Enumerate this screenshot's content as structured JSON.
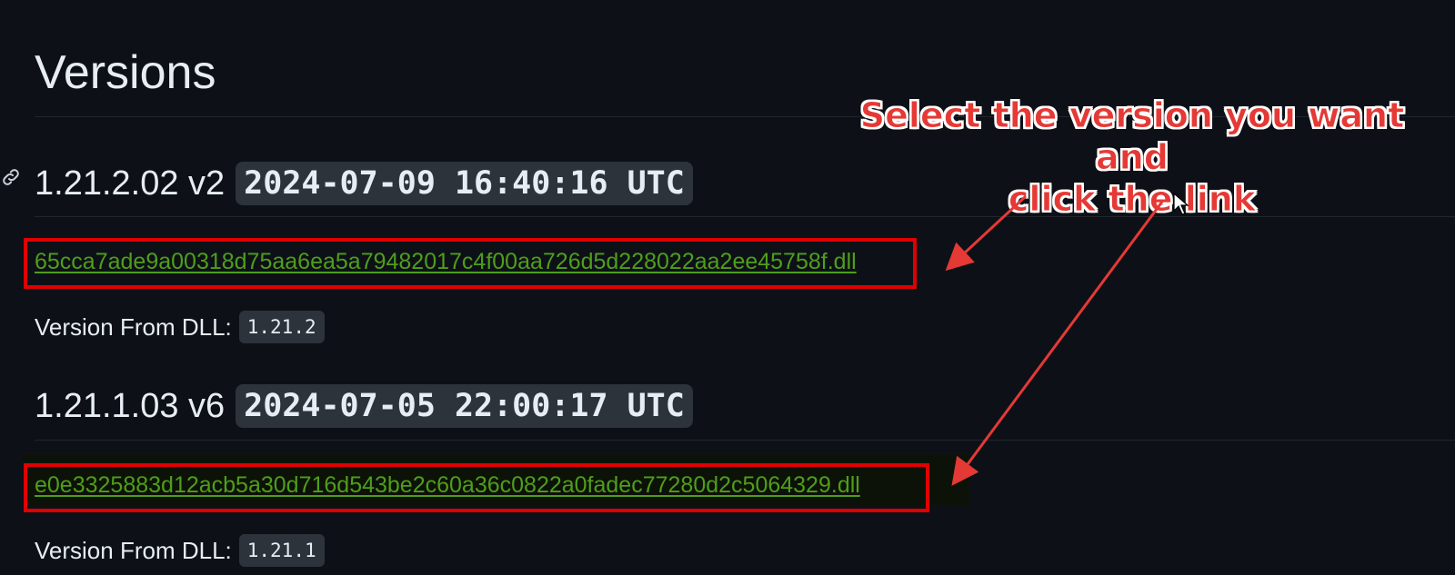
{
  "page": {
    "title": "Versions"
  },
  "versions": [
    {
      "name": "1.21.2.02 v2",
      "date": "2024-07-09 16:40:16 UTC",
      "dll": "65cca7ade9a00318d75aa6ea5a79482017c4f00aa726d5d228022aa2ee45758f.dll",
      "dll_version_label": "Version From DLL:",
      "dll_version": "1.21.2"
    },
    {
      "name": "1.21.1.03 v6",
      "date": "2024-07-05 22:00:17 UTC",
      "dll": "e0e3325883d12acb5a30d716d543be2c60a36c0822a0fadec77280d2c5064329.dll",
      "dll_version_label": "Version From DLL:",
      "dll_version": "1.21.1"
    }
  ],
  "annotation": {
    "line1": "Select the version you want and",
    "line2": "click the link"
  },
  "icons": {
    "anchor": "link-icon",
    "cursor": "mouse-cursor-icon"
  },
  "colors": {
    "background": "#0d1117",
    "text": "#e6edf3",
    "border": "#21262d",
    "code_bg": "#2d333b",
    "link": "#4f9e1a",
    "annotation_box": "#e00000",
    "annotation_text": "#e53935",
    "arrow": "#e53935"
  }
}
